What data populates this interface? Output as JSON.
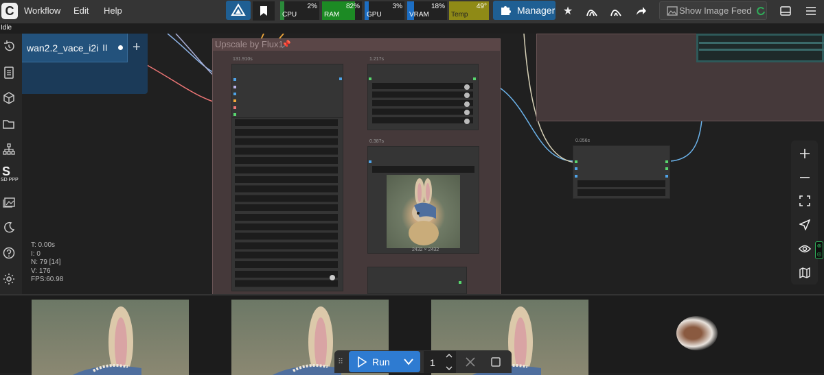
{
  "menu": {
    "workflow": "Workflow",
    "edit": "Edit",
    "help": "Help"
  },
  "status": "Idle",
  "monitor": {
    "cpu": {
      "label": "CPU",
      "value": "2%",
      "fraction": 0.02,
      "color": "#2a8a3a"
    },
    "ram": {
      "label": "RAM",
      "value": "82%",
      "fraction": 0.82,
      "color": "#1c8a24"
    },
    "gpu": {
      "label": "GPU",
      "value": "3%",
      "fraction": 0.03,
      "color": "#1c6ec4"
    },
    "vram": {
      "label": "VRAM",
      "value": "18%",
      "fraction": 0.18,
      "color": "#1c6ec4"
    },
    "temp": {
      "label": "Temp",
      "value": "49°",
      "fraction": 0.49,
      "color": "#8f8a16"
    }
  },
  "toolbar": {
    "manager": "Manager",
    "show_image_feed": "Show Image Feed"
  },
  "tab": {
    "name": "wan2.2_vace_i2i"
  },
  "sidebar": {
    "sdppp": "SD PPP"
  },
  "canvas": {
    "group_title": "Upscale by Flux1",
    "node_times": [
      "131.910s",
      "1.217s",
      "0.387s",
      "0.056s"
    ],
    "image_size": "2432 × 2432"
  },
  "graph_stats": {
    "t": "T: 0.00s",
    "i": "I: 0",
    "n": "N: 79 [14]",
    "v": "V: 176",
    "fps": "FPS:60.98"
  },
  "run": {
    "label": "Run",
    "count": "1"
  },
  "colors": {
    "accent": "#2e7bd1",
    "group_bg": "#45393a"
  }
}
